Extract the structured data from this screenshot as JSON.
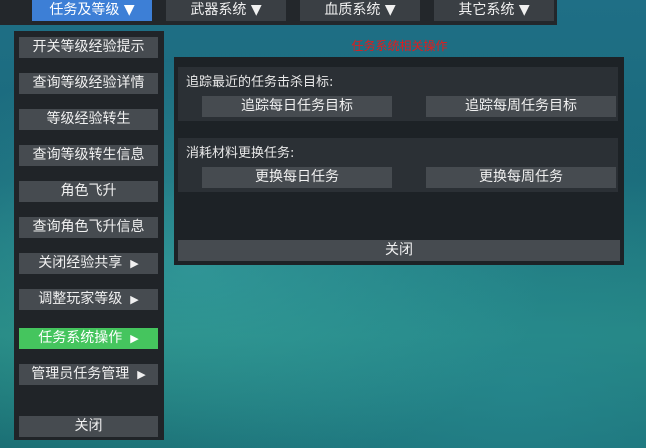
{
  "top_tabs": [
    {
      "label": "任务及等级 ▼",
      "active": true
    },
    {
      "label": "武器系统 ▼",
      "active": false
    },
    {
      "label": "血质系统 ▼",
      "active": false
    },
    {
      "label": "其它系统 ▼",
      "active": false
    }
  ],
  "left_menu": {
    "items": [
      {
        "label": "开关等级经验提示"
      },
      {
        "label": "查询等级经验详情"
      },
      {
        "label": "等级经验转生"
      },
      {
        "label": "查询等级转生信息"
      },
      {
        "label": "角色飞升"
      },
      {
        "label": "查询角色飞升信息"
      },
      {
        "label": "关闭经验共享",
        "arrow": "▶"
      },
      {
        "label": "调整玩家等级",
        "arrow": "▶"
      },
      {
        "label": "任务系统操作",
        "arrow": "▶",
        "active": true
      },
      {
        "label": "管理员任务管理",
        "arrow": "▶"
      }
    ],
    "close_label": "关闭"
  },
  "panel": {
    "title": "任务系统相关操作",
    "track_section": {
      "label": "追踪最近的任务击杀目标:",
      "daily_button": "追踪每日任务目标",
      "weekly_button": "追踪每周任务目标"
    },
    "replace_section": {
      "label": "消耗材料更换任务:",
      "daily_button": "更换每日任务",
      "weekly_button": "更换每周任务"
    },
    "close_label": "关闭"
  },
  "colors": {
    "active_tab": "#3d7fd6",
    "active_menu_item": "#45c55e",
    "panel_title": "#e21c1c"
  }
}
